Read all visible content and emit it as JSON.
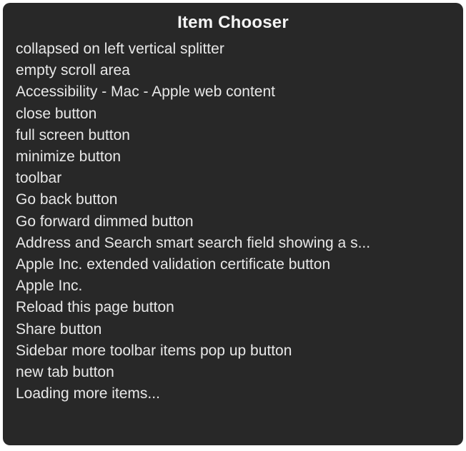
{
  "title": "Item Chooser",
  "items": [
    "collapsed on left vertical splitter",
    "empty scroll area",
    "Accessibility - Mac - Apple web content",
    "close button",
    "full screen button",
    "minimize button",
    "toolbar",
    "Go back button",
    "Go forward dimmed button",
    "Address and Search smart search field showing a s...",
    "Apple Inc. extended validation certificate button",
    "Apple Inc.",
    "Reload this page button",
    "Share button",
    "Sidebar more toolbar items pop up button",
    "new tab button",
    "Loading more items..."
  ]
}
